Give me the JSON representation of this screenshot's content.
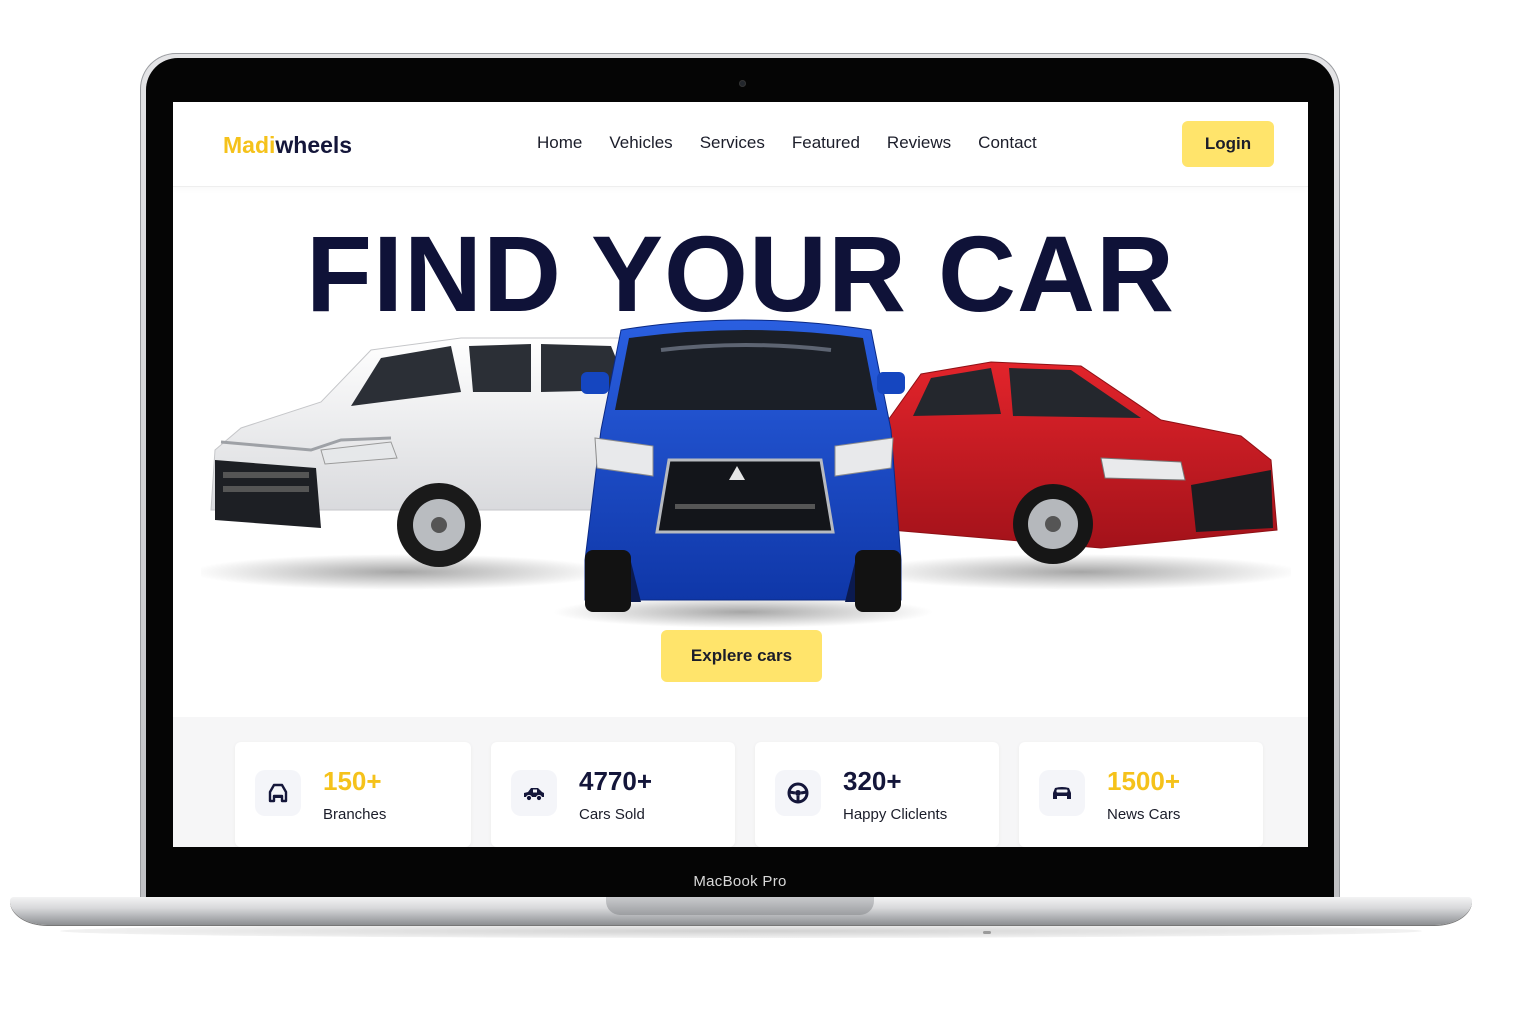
{
  "device": {
    "bezel_label": "MacBook Pro"
  },
  "site": {
    "logo": {
      "accent_part": "Madi",
      "rest_part": "wheels"
    },
    "nav": [
      "Home",
      "Vehicles",
      "Services",
      "Featured",
      "Reviews",
      "Contact"
    ],
    "login_label": "Login"
  },
  "hero": {
    "title": "FIND YOUR CAR",
    "cta_label": "Explere cars",
    "cars": [
      "white-suv",
      "blue-crossover",
      "red-sedan"
    ]
  },
  "stats": [
    {
      "value": "150+",
      "label": "Branches",
      "icon": "garage-icon",
      "highlight": true
    },
    {
      "value": "4770+",
      "label": "Cars Sold",
      "icon": "car-side-icon",
      "highlight": false
    },
    {
      "value": "320+",
      "label": "Happy Cliclents",
      "icon": "steering-wheel-icon",
      "highlight": false
    },
    {
      "value": "1500+",
      "label": "News Cars",
      "icon": "car-front-icon",
      "highlight": true
    }
  ],
  "colors": {
    "accent_yellow": "#ffe46b",
    "accent_gold_text": "#f5c21b",
    "navy": "#0f1238",
    "stats_band_bg": "#f6f6f7"
  }
}
